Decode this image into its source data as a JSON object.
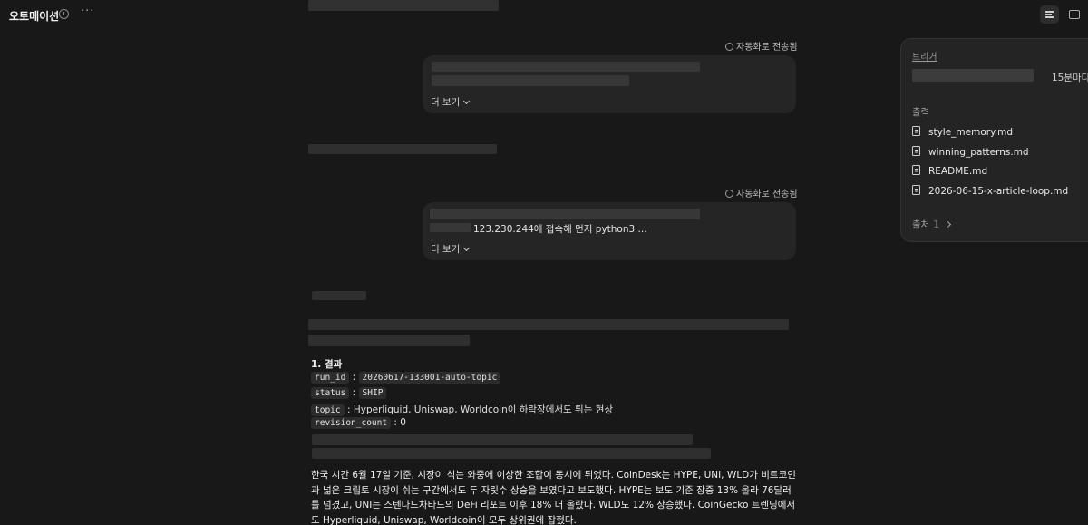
{
  "header": {
    "title": "오토메이션",
    "clock_icon": "clock-icon",
    "more_icon": "more-icon",
    "more_glyph": "···"
  },
  "messages": [
    {
      "sent_label": "자동화로 전송됨",
      "more_label": "더 보기"
    },
    {
      "sent_label": "자동화로 전송됨",
      "visible_text": "123.230.244에 접속해 먼저 python3  ...",
      "more_label": "더 보기"
    }
  ],
  "result": {
    "heading": "1. 결과",
    "fields": [
      {
        "key": "run_id",
        "sep": " : ",
        "value": "20260617-133001-auto-topic",
        "value_is_code": true
      },
      {
        "key": "status",
        "sep": " : ",
        "value": "SHIP",
        "value_is_code": true
      },
      {
        "key": "topic",
        "sep": " : ",
        "value": "Hyperliquid, Uniswap, Worldcoin이 하락장에서도 튀는 현상",
        "value_is_code": false
      },
      {
        "key": "revision_count",
        "sep": " : ",
        "value": "0",
        "value_is_code": false
      }
    ],
    "paragraph": "한국 시간 6월 17일 기준, 시장이 식는 와중에 이상한 조합이 동시에 튀었다. CoinDesk는 HYPE, UNI, WLD가 비트코인과 넓은 크립토 시장이 쉬는 구간에서도 두 자릿수 상승을 보였다고 보도했다. HYPE는 보도 기준 장중 13% 올라 76달러를 넘겼고, UNI는 스텐다드차타드의 DeFi 리포트 이후 18% 더 올랐다. WLD도 12% 상승했다. CoinGecko 트렌딩에서도 Hyperliquid, Uniswap, Worldcoin이 모두 상위권에 잡혔다."
  },
  "panel": {
    "trigger_title": "트리거",
    "schedule": "15분마다",
    "output_title": "출력",
    "files": [
      "style_memory.md",
      "winning_patterns.md",
      "README.md",
      "2026-06-15-x-article-loop.md"
    ],
    "sources_label": "출처",
    "sources_count": "1"
  },
  "colors": {
    "background": "#181818",
    "bubble": "#252525",
    "panel": "#242424",
    "code_bg": "#2c2c2c"
  }
}
